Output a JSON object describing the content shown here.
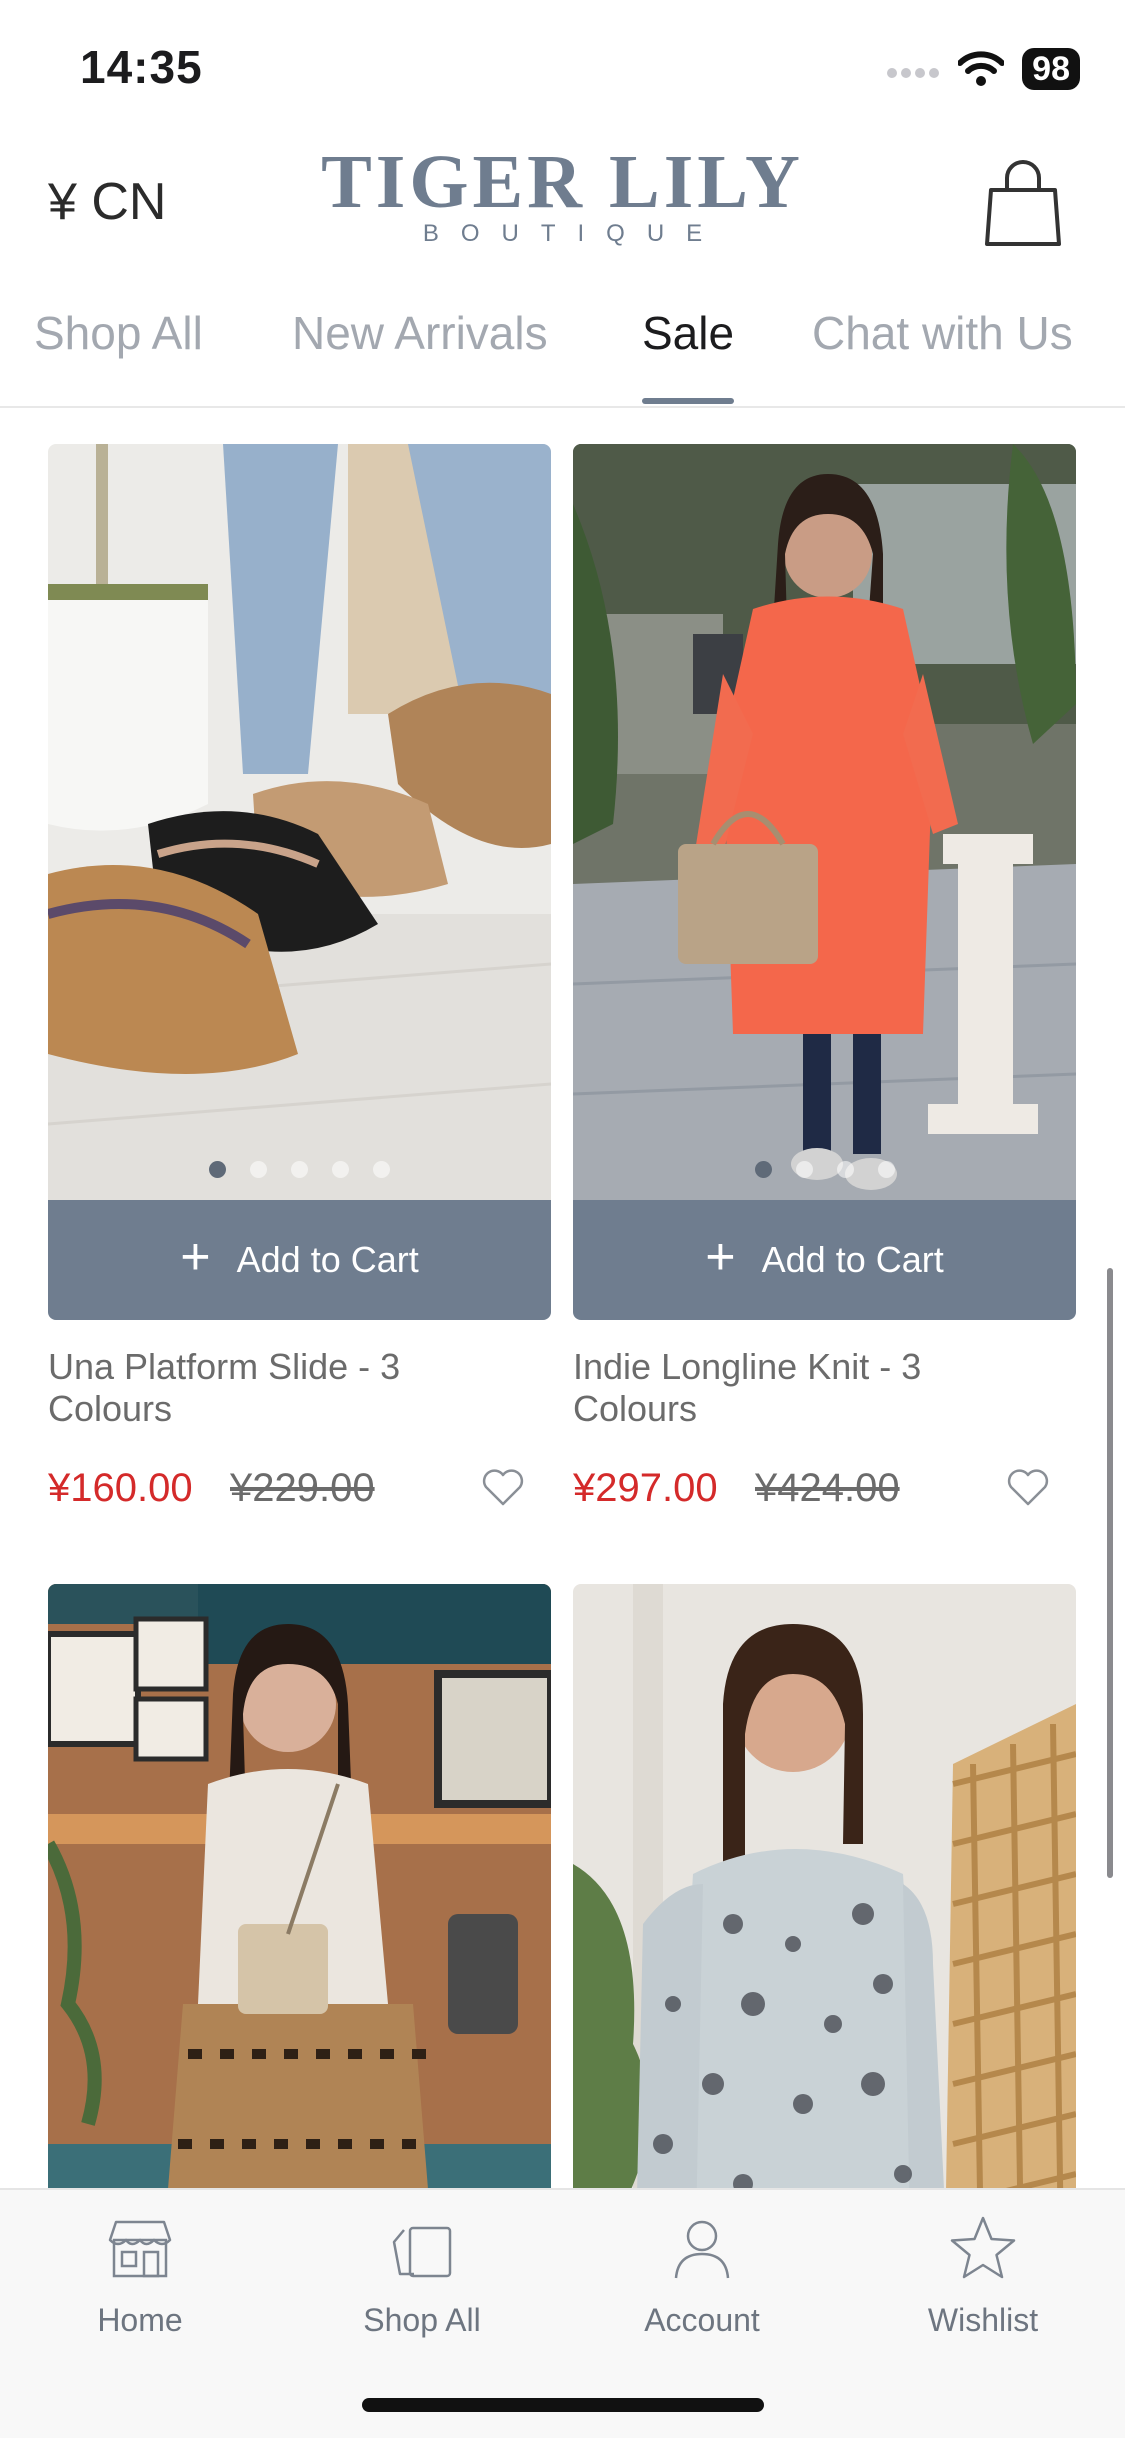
{
  "status_bar": {
    "time": "14:35",
    "battery": "98"
  },
  "header": {
    "currency": "¥ CN",
    "logo_main": "TIGER LILY",
    "logo_sub": "BOUTIQUE",
    "bag_icon": "shopping-bag-icon"
  },
  "tabs": [
    {
      "label": "Shop All",
      "active": false
    },
    {
      "label": "New Arrivals",
      "active": false
    },
    {
      "label": "Sale",
      "active": true
    },
    {
      "label": "Chat with Us",
      "active": false
    }
  ],
  "products": [
    {
      "name": "Una Platform Slide - 3 Colours",
      "sale_price": "¥160.00",
      "original_price": "¥229.00",
      "cart_label": "Add to Cart",
      "image_count": 5,
      "active_image": 1
    },
    {
      "name": "Indie Longline Knit - 3 Colours",
      "sale_price": "¥297.00",
      "original_price": "¥424.00",
      "cart_label": "Add to Cart",
      "image_count": 4,
      "active_image": 1
    },
    {
      "name": "",
      "sale_price": "",
      "original_price": ""
    },
    {
      "name": "",
      "sale_price": "",
      "original_price": ""
    }
  ],
  "bottom_nav": [
    {
      "label": "Home",
      "icon": "storefront-icon"
    },
    {
      "label": "Shop All",
      "icon": "shopping-bags-icon"
    },
    {
      "label": "Account",
      "icon": "person-icon"
    },
    {
      "label": "Wishlist",
      "icon": "star-icon"
    }
  ],
  "colors": {
    "accent": "#6f7d8f",
    "sale_price": "#d42a2a",
    "muted_text": "#a3a8b0"
  }
}
